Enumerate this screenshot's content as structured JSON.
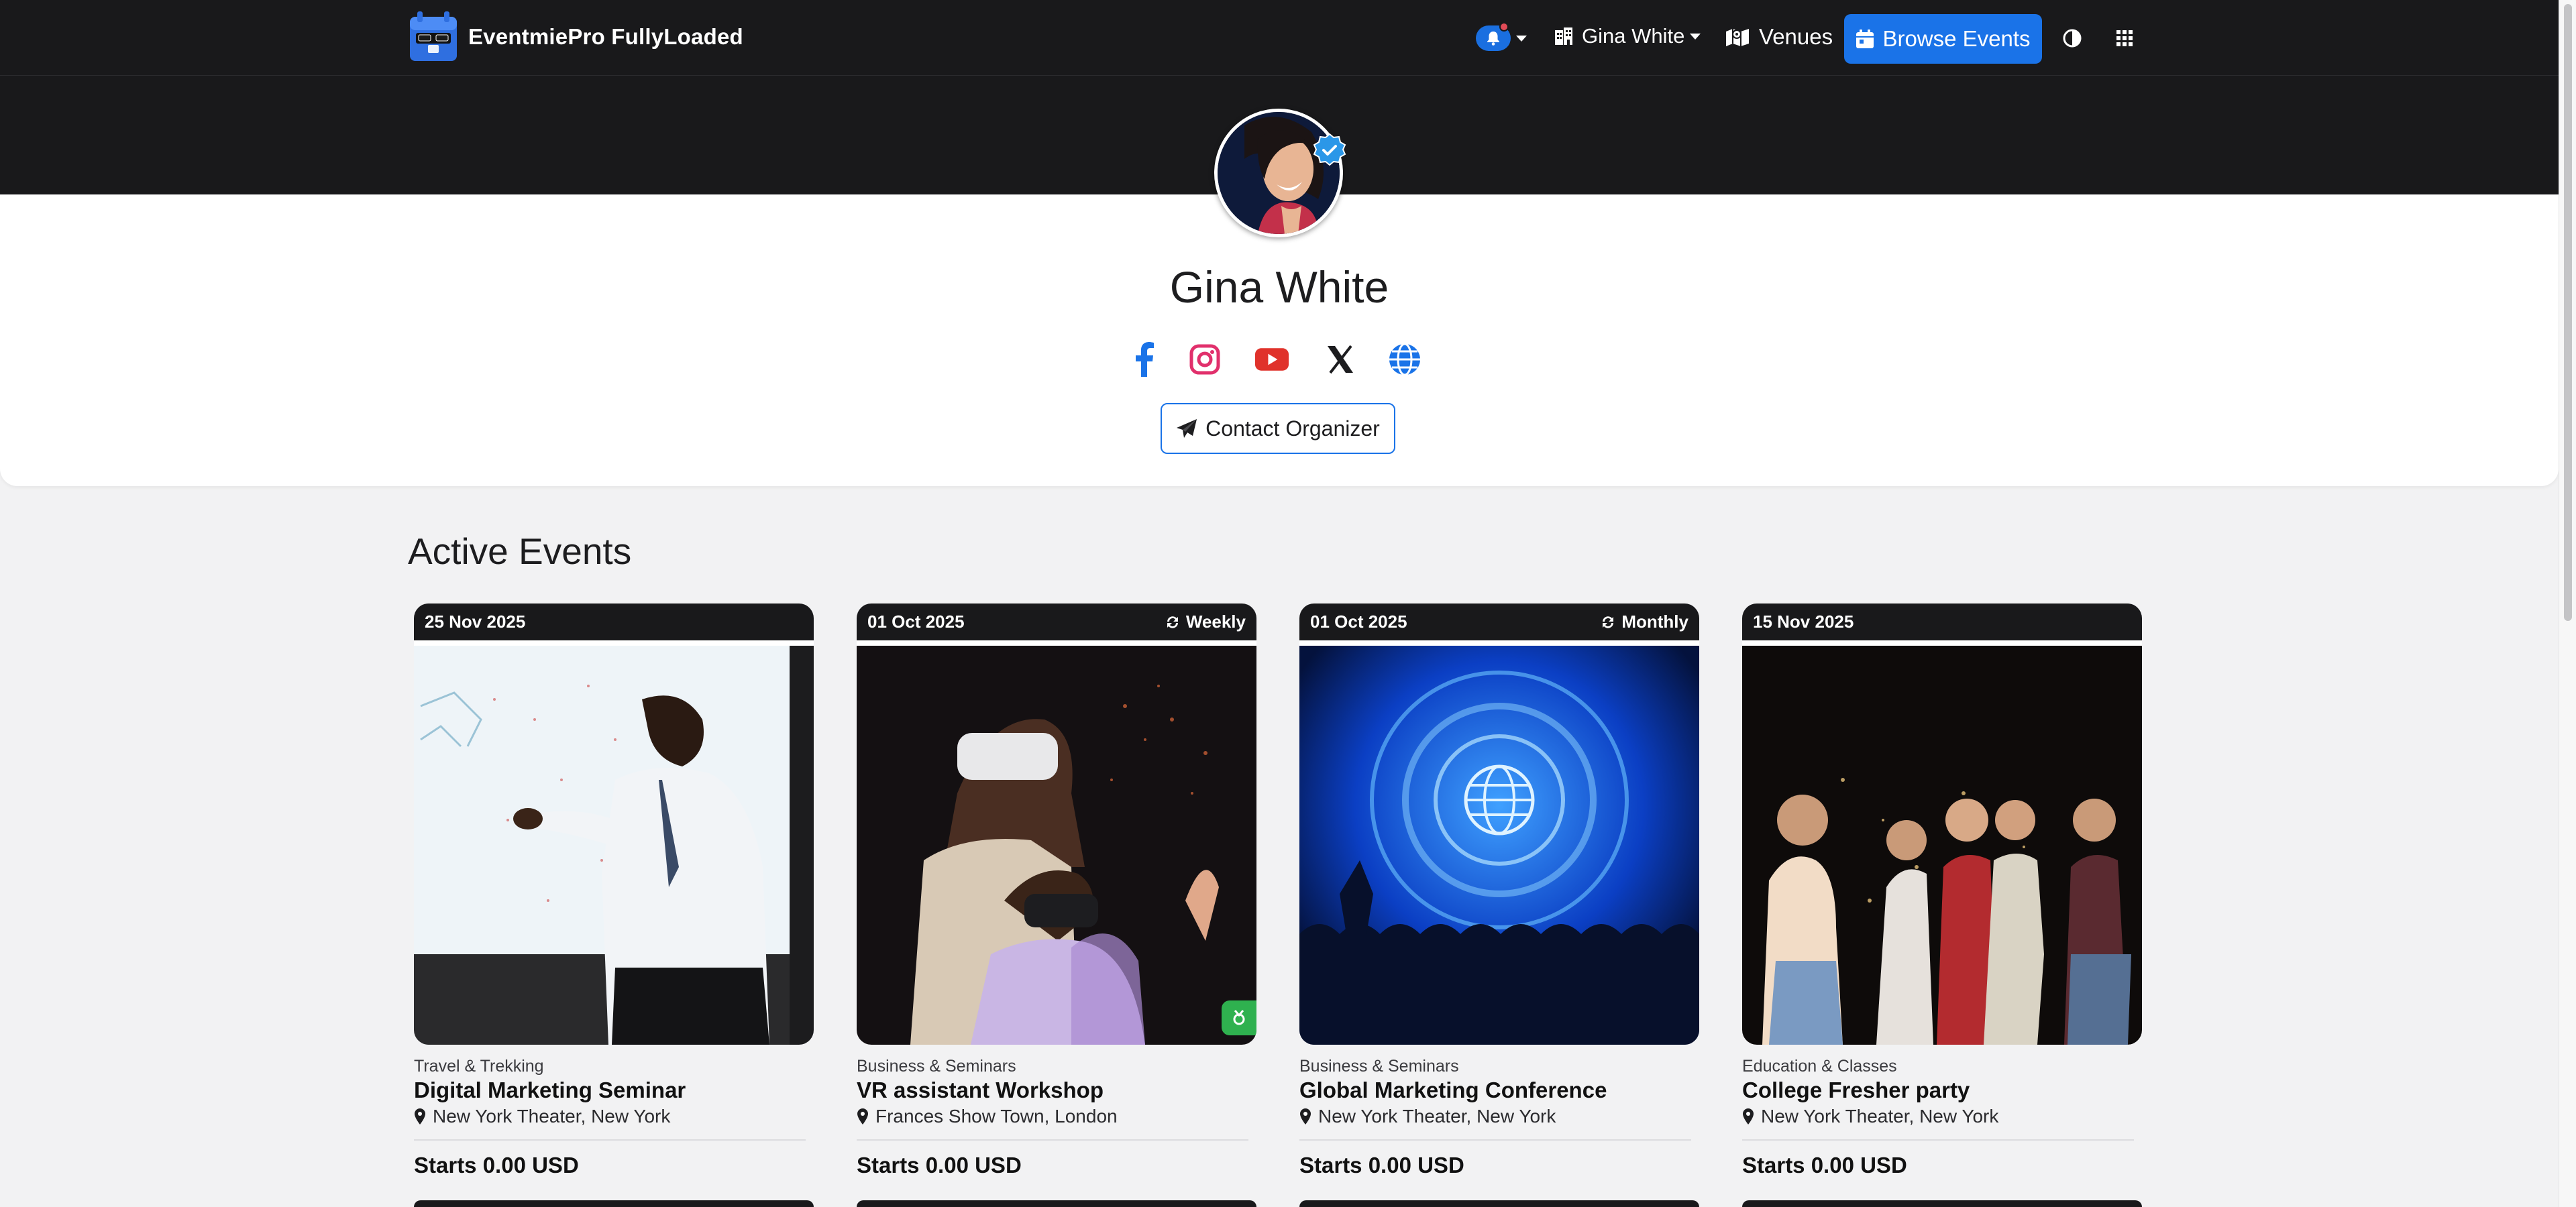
{
  "navbar": {
    "brand_name": "EventmiePro FullyLoaded",
    "user_name": "Gina White",
    "venues_label": "Venues",
    "browse_label": "Browse Events"
  },
  "profile": {
    "name": "Gina White",
    "contact_label": "Contact Organizer",
    "socials": [
      "facebook-icon",
      "instagram-icon",
      "youtube-icon",
      "x-icon",
      "globe-icon"
    ]
  },
  "events": {
    "title": "Active Events",
    "cards": [
      {
        "date": "25 Nov 2025",
        "repeat": "",
        "category": "Travel & Trekking",
        "title": "Digital Marketing Seminar",
        "location": "New York Theater, New York",
        "price": "Starts 0.00 USD"
      },
      {
        "date": "01 Oct 2025",
        "repeat": "Weekly",
        "category": "Business & Seminars",
        "title": "VR assistant Workshop",
        "location": "Frances Show Town, London",
        "price": "Starts 0.00 USD"
      },
      {
        "date": "01 Oct 2025",
        "repeat": "Monthly",
        "category": "Business & Seminars",
        "title": "Global Marketing Conference",
        "location": "New York Theater, New York",
        "price": "Starts 0.00 USD"
      },
      {
        "date": "15 Nov 2025",
        "repeat": "",
        "category": "Education & Classes",
        "title": "College Fresher party",
        "location": "New York Theater, New York",
        "price": "Starts 0.00 USD"
      }
    ]
  },
  "colors": {
    "accent": "#1a73e8",
    "navbar_bg": "#19191b",
    "page_bg": "#f2f2f3",
    "youtube": "#e0322b",
    "instagram": "#e1306c",
    "badge_green": "#2fb14f"
  }
}
